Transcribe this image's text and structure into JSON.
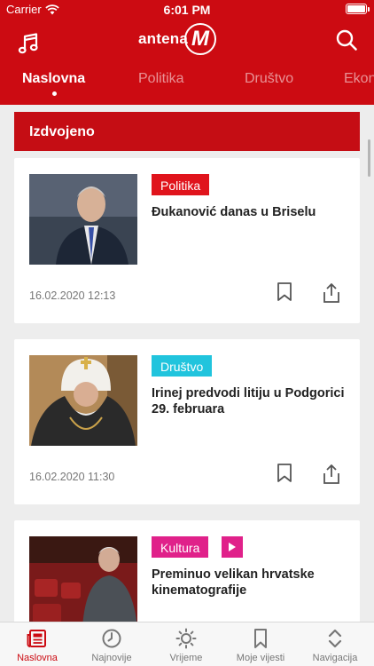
{
  "status_bar": {
    "carrier": "Carrier",
    "time": "6:01 PM"
  },
  "header": {
    "brand": {
      "word": "antena",
      "mark": "M"
    },
    "left_icon": "music-note-icon",
    "right_icon": "search-icon",
    "accent_color": "#cc0b12"
  },
  "tabs": [
    {
      "label": "Naslovna",
      "active": true
    },
    {
      "label": "Politika"
    },
    {
      "label": "Društvo"
    },
    {
      "label": "Ekon"
    }
  ],
  "section": {
    "title": "Izdvojeno"
  },
  "articles": [
    {
      "category": "Politika",
      "category_color": "#e0141c",
      "title": "Đukanović danas u Briselu",
      "date": "16.02.2020 12:13"
    },
    {
      "category": "Društvo",
      "category_color": "#21c4dd",
      "title": "Irinej predvodi litiju u Podgorici 29. februara",
      "date": "16.02.2020 11:30"
    },
    {
      "category": "Kultura",
      "category_color": "#e0218a",
      "title": "Preminuo velikan hrvatske kinematografije",
      "has_video": true
    }
  ],
  "tab_bar": [
    {
      "label": "Naslovna",
      "icon": "newspaper-icon",
      "active": true
    },
    {
      "label": "Najnovije",
      "icon": "clock-icon"
    },
    {
      "label": "Vrijeme",
      "icon": "sun-icon"
    },
    {
      "label": "Moje vijesti",
      "icon": "bookmark-icon"
    },
    {
      "label": "Navigacija",
      "icon": "chevron-updown-icon"
    }
  ]
}
